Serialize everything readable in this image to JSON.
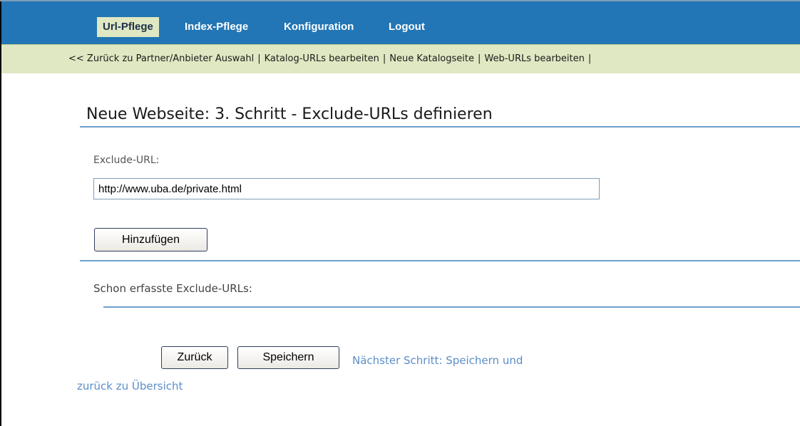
{
  "nav": {
    "items": [
      "Url-Pflege",
      "Index-Pflege",
      "Konfiguration",
      "Logout"
    ]
  },
  "subnav": {
    "links": [
      "<< Zurück zu Partner/Anbieter Auswahl",
      "Katalog-URLs bearbeiten",
      "Neue Katalogseite",
      "Web-URLs bearbeiten"
    ],
    "separator": "|"
  },
  "page": {
    "title": "Neue Webseite: 3. Schritt - Exclude-URLs definieren"
  },
  "form": {
    "exclude_label": "Exclude-URL:",
    "exclude_value": "http://www.uba.de/private.html",
    "add_button": "Hinzufügen"
  },
  "existing": {
    "label": "Schon erfasste Exclude-URLs:"
  },
  "actions": {
    "back_button": "Zurück",
    "save_button": "Speichern",
    "next_step_line1": "Nächster Schritt: Speichern und",
    "next_step_line2": "zurück zu Übersicht"
  },
  "colors": {
    "nav_bg": "#2276b5",
    "subnav_bg": "#dfe8c2",
    "rule": "#6f9fcb",
    "link": "#5b8ec9"
  }
}
